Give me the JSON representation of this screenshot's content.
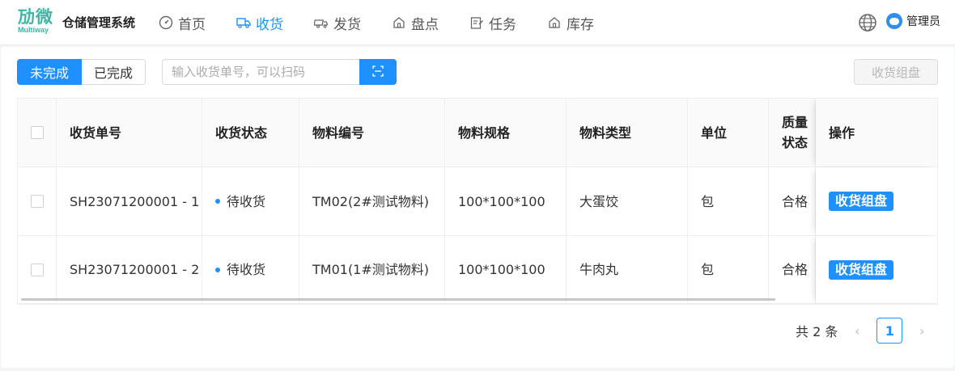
{
  "header": {
    "logo_text": "劢微",
    "logo_sub": "Multiway",
    "app_title": "仓储管理系统",
    "nav": [
      {
        "label": "首页",
        "icon": "dashboard-icon"
      },
      {
        "label": "收货",
        "icon": "truck-icon",
        "active": true
      },
      {
        "label": "发货",
        "icon": "shipping-icon"
      },
      {
        "label": "盘点",
        "icon": "home-icon"
      },
      {
        "label": "任务",
        "icon": "edit-icon"
      },
      {
        "label": "库存",
        "icon": "home-icon"
      }
    ],
    "language_icon": "globe-icon",
    "user_name": "管理员"
  },
  "toolbar": {
    "tab_incomplete": "未完成",
    "tab_complete": "已完成",
    "search_placeholder": "输入收货单号，可以扫码",
    "scan_icon": "scan-icon",
    "combine_button": "收货组盘"
  },
  "table": {
    "columns": [
      "收货单号",
      "收货状态",
      "物料编号",
      "物料规格",
      "物料类型",
      "单位",
      "质量状态",
      "操作"
    ],
    "rows": [
      {
        "order": "SH23071200001 - 1",
        "status": "待收货",
        "material_code": "TM02(2#测试物料)",
        "spec": "100*100*100",
        "type": "大蛋饺",
        "unit": "包",
        "quality": "合格",
        "action": "收货组盘"
      },
      {
        "order": "SH23071200001 - 2",
        "status": "待收货",
        "material_code": "TM01(1#测试物料)",
        "spec": "100*100*100",
        "type": "牛肉丸",
        "unit": "包",
        "quality": "合格",
        "action": "收货组盘"
      }
    ]
  },
  "pagination": {
    "total_text": "共 2 条",
    "current_page": "1"
  },
  "colors": {
    "primary": "#1e90ff",
    "logo": "#3fb5a3"
  }
}
